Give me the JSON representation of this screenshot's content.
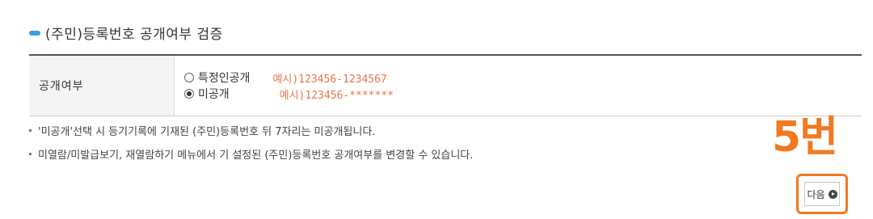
{
  "section": {
    "title": "(주민)등록번호 공개여부 검증"
  },
  "form": {
    "label": "공개여부",
    "options": [
      {
        "label": "특정인공개",
        "example": "예시)123456-1234567",
        "checked": false
      },
      {
        "label": "미공개",
        "example": "예시)123456-*******",
        "checked": true
      }
    ]
  },
  "notes": [
    "'미공개'선택 시 등기기록에 기재된 (주민)등록번호 뒤 7자리는 미공개됩니다.",
    "미열람/미발급보기, 재열람하기 메뉴에서 기 설정된 (주민)등록번호 공개여부를 변경할 수 있습니다."
  ],
  "annotation": {
    "step": "5번",
    "color": "#f07a22"
  },
  "next_button": {
    "label": "다음",
    "icon": "circle-arrow-right-icon"
  },
  "colors": {
    "accent": "#3b9fe0",
    "example_text": "#e8764a"
  }
}
